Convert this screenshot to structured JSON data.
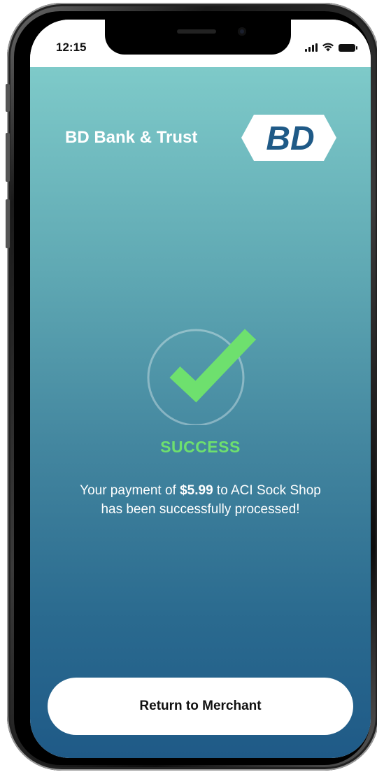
{
  "status_bar": {
    "time": "12:15"
  },
  "header": {
    "bank_name": "BD Bank & Trust",
    "logo_text": "BD",
    "logo_color": "#1f5a87"
  },
  "result": {
    "status_label": "SUCCESS",
    "status_color": "#6ee06e",
    "message_prefix": "Your payment of ",
    "amount": "$5.99",
    "message_middle": " to ACI Sock Shop",
    "message_suffix": "has been successfully processed!"
  },
  "actions": {
    "return_label": "Return to Merchant"
  },
  "icons": {
    "success": "check-circle-icon",
    "signal": "signal-icon",
    "wifi": "wifi-icon",
    "battery": "battery-icon"
  }
}
